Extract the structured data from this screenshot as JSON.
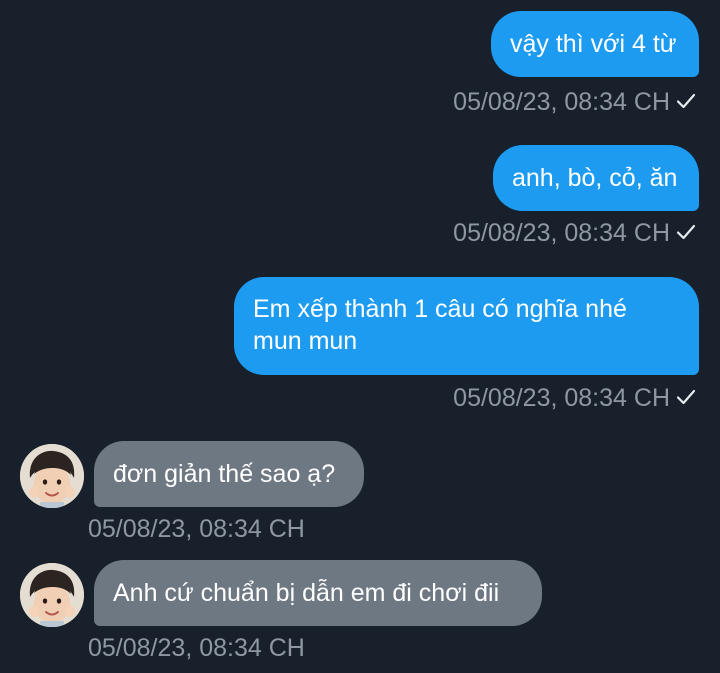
{
  "messages": [
    {
      "direction": "outgoing",
      "text": "vậy thì với 4 từ",
      "time": "05/08/23, 08:34 CH",
      "status_icon": "check-icon"
    },
    {
      "direction": "outgoing",
      "text": "anh, bò, cỏ, ăn",
      "time": "05/08/23, 08:34 CH",
      "status_icon": "check-icon"
    },
    {
      "direction": "outgoing",
      "text": "Em xếp thành 1 câu có nghĩa nhé mun mun",
      "time": "05/08/23, 08:34 CH",
      "status_icon": "check-icon"
    },
    {
      "direction": "incoming",
      "text": "đơn giản thế sao ạ?",
      "time": "05/08/23, 08:34 CH",
      "avatar": "avatar"
    },
    {
      "direction": "incoming",
      "text": "Anh cứ chuẩn bị dẫn em đi chơi đii",
      "time": "05/08/23, 08:34 CH",
      "avatar": "avatar"
    }
  ],
  "colors": {
    "background": "#17202b",
    "outgoing_bubble": "#1d9bf0",
    "incoming_bubble": "#6e7883",
    "timestamp": "#8e97a2"
  }
}
